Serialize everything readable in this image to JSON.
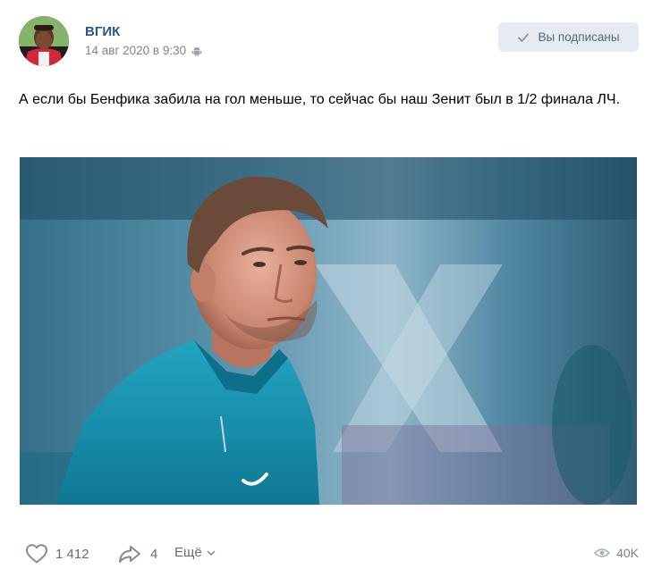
{
  "post": {
    "author": "ВГИК",
    "date": "14 авг 2020 в 9:30",
    "subscribe_label": "Вы подписаны",
    "text": "А если бы Бенфика забила на гол меньше, то сейчас бы наш Зенит был в 1/2 финала ЛЧ."
  },
  "actions": {
    "likes": "1 412",
    "shares": "4",
    "more_label": "Ещё",
    "views": "40K"
  },
  "icons": {
    "avatar": "avatar-photo",
    "device": "android-icon",
    "subscribe": "check-icon",
    "like": "heart-icon",
    "share": "share-arrow-icon",
    "more": "chevron-down-icon",
    "views": "eye-icon"
  },
  "colors": {
    "author_link": "#2a5885",
    "secondary_text": "#828282",
    "button_bg": "#e5ebf1",
    "button_text": "#55677d",
    "action_text": "#626d7a"
  }
}
